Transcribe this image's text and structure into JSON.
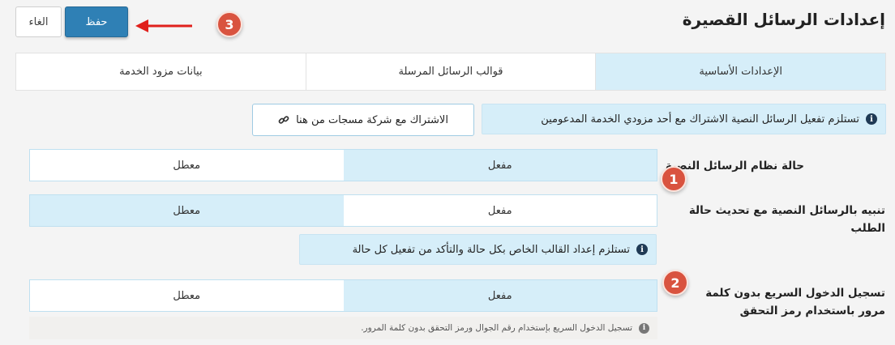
{
  "header": {
    "title": "إعدادات الرسائل القصيرة",
    "cancel_label": "الغاء",
    "save_label": "حفظ"
  },
  "tabs": [
    {
      "label": "الإعدادات الأساسية",
      "active": true
    },
    {
      "label": "قوالب الرسائل المرسلة",
      "active": false
    },
    {
      "label": "بيانات مزود الخدمة",
      "active": false
    }
  ],
  "notice": {
    "text": "تستلزم تفعيل الرسائل النصية الاشتراك مع أحد مزودي الخدمة المدعومين",
    "subscribe_label": "الاشتراك مع شركة مسجات من هنا"
  },
  "settings": [
    {
      "label": "حالة نظام الرسائل النصية",
      "on_label": "مفعل",
      "off_label": "معطل",
      "selected": "on"
    },
    {
      "label": "تنبيه بالرسائل النصية مع تحديث حالة الطلب",
      "on_label": "مفعل",
      "off_label": "معطل",
      "selected": "off",
      "note": "تستلزم إعداد القالب الخاص بكل حالة والتأكد من تفعيل كل حالة"
    },
    {
      "label": "تسجيل الدخول السريع بدون كلمة مرور باستخدام رمز التحقق",
      "on_label": "مفعل",
      "off_label": "معطل",
      "selected": "on",
      "help": "تسجيل الدخول السريع بإستخدام رقم الجوال ورمز التحقق بدون كلمة المرور."
    }
  ],
  "annotations": [
    "1",
    "2",
    "3"
  ],
  "colors": {
    "primary": "#2f80b5",
    "highlight": "#d6eef9",
    "badge": "#d9533f",
    "arrow": "#e0201c"
  }
}
